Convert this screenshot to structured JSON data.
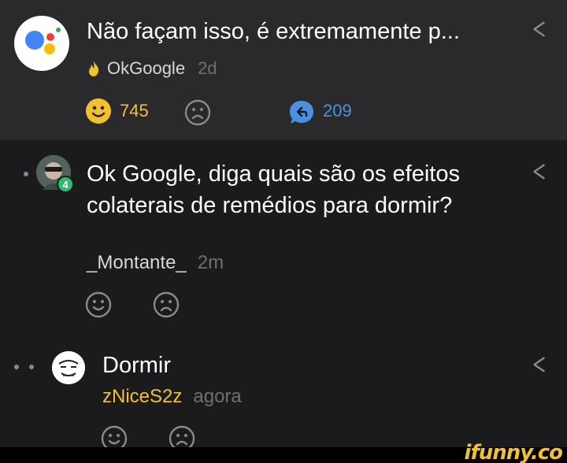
{
  "post": {
    "title": "Não façam isso, é extremamente p...",
    "author": "OkGoogle",
    "time": "2d",
    "likes": "745",
    "replies": "209"
  },
  "comments": [
    {
      "text": "Ok Google, diga quais são os efeitos colaterais de remédios para dormir?",
      "author": "_Montante_",
      "time": "2m",
      "level": "4"
    },
    {
      "text": "Dormir",
      "author": "zNiceS2z",
      "time": "agora"
    }
  ],
  "watermark": "ifunny.co",
  "colors": {
    "background": "#1b1b1d",
    "header_bg": "#2a2a2c",
    "accent_yellow": "#f2c12e",
    "accent_blue": "#4a90e2",
    "level_green": "#2ebc6e"
  },
  "icons": {
    "post_avatar": "google-assistant-icon",
    "flame": "flame-icon",
    "like": "smile-icon",
    "dislike": "frown-icon",
    "reply": "reply-bubble-icon",
    "share": "share-icon"
  }
}
